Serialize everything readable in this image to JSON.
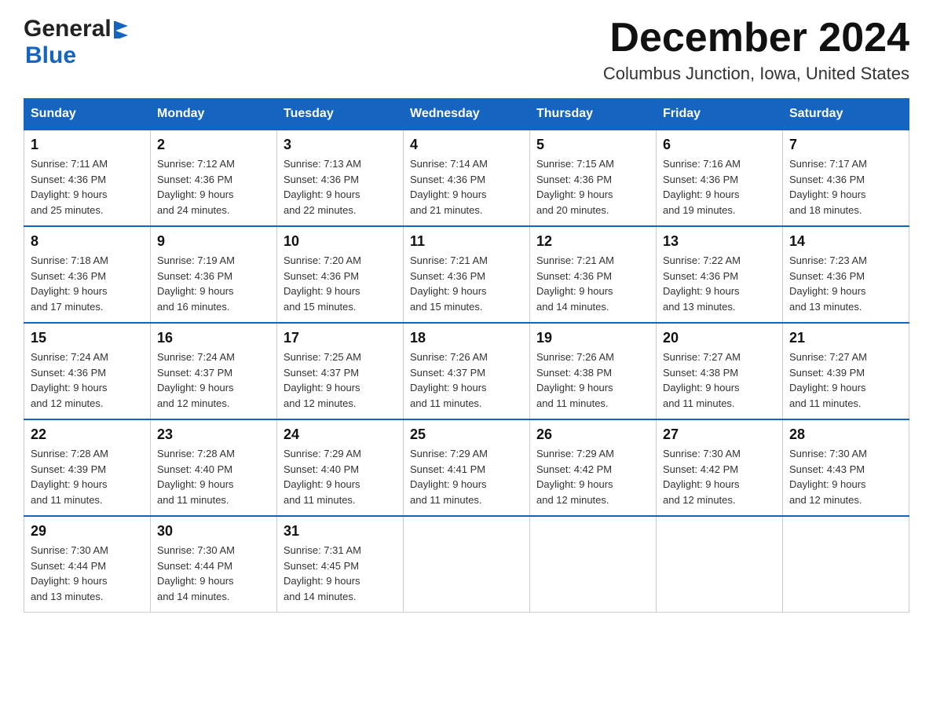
{
  "header": {
    "logo_general": "General",
    "logo_blue": "Blue",
    "month_title": "December 2024",
    "location": "Columbus Junction, Iowa, United States"
  },
  "weekdays": [
    "Sunday",
    "Monday",
    "Tuesday",
    "Wednesday",
    "Thursday",
    "Friday",
    "Saturday"
  ],
  "weeks": [
    [
      {
        "day": "1",
        "sunrise": "7:11 AM",
        "sunset": "4:36 PM",
        "daylight": "9 hours and 25 minutes."
      },
      {
        "day": "2",
        "sunrise": "7:12 AM",
        "sunset": "4:36 PM",
        "daylight": "9 hours and 24 minutes."
      },
      {
        "day": "3",
        "sunrise": "7:13 AM",
        "sunset": "4:36 PM",
        "daylight": "9 hours and 22 minutes."
      },
      {
        "day": "4",
        "sunrise": "7:14 AM",
        "sunset": "4:36 PM",
        "daylight": "9 hours and 21 minutes."
      },
      {
        "day": "5",
        "sunrise": "7:15 AM",
        "sunset": "4:36 PM",
        "daylight": "9 hours and 20 minutes."
      },
      {
        "day": "6",
        "sunrise": "7:16 AM",
        "sunset": "4:36 PM",
        "daylight": "9 hours and 19 minutes."
      },
      {
        "day": "7",
        "sunrise": "7:17 AM",
        "sunset": "4:36 PM",
        "daylight": "9 hours and 18 minutes."
      }
    ],
    [
      {
        "day": "8",
        "sunrise": "7:18 AM",
        "sunset": "4:36 PM",
        "daylight": "9 hours and 17 minutes."
      },
      {
        "day": "9",
        "sunrise": "7:19 AM",
        "sunset": "4:36 PM",
        "daylight": "9 hours and 16 minutes."
      },
      {
        "day": "10",
        "sunrise": "7:20 AM",
        "sunset": "4:36 PM",
        "daylight": "9 hours and 15 minutes."
      },
      {
        "day": "11",
        "sunrise": "7:21 AM",
        "sunset": "4:36 PM",
        "daylight": "9 hours and 15 minutes."
      },
      {
        "day": "12",
        "sunrise": "7:21 AM",
        "sunset": "4:36 PM",
        "daylight": "9 hours and 14 minutes."
      },
      {
        "day": "13",
        "sunrise": "7:22 AM",
        "sunset": "4:36 PM",
        "daylight": "9 hours and 13 minutes."
      },
      {
        "day": "14",
        "sunrise": "7:23 AM",
        "sunset": "4:36 PM",
        "daylight": "9 hours and 13 minutes."
      }
    ],
    [
      {
        "day": "15",
        "sunrise": "7:24 AM",
        "sunset": "4:36 PM",
        "daylight": "9 hours and 12 minutes."
      },
      {
        "day": "16",
        "sunrise": "7:24 AM",
        "sunset": "4:37 PM",
        "daylight": "9 hours and 12 minutes."
      },
      {
        "day": "17",
        "sunrise": "7:25 AM",
        "sunset": "4:37 PM",
        "daylight": "9 hours and 12 minutes."
      },
      {
        "day": "18",
        "sunrise": "7:26 AM",
        "sunset": "4:37 PM",
        "daylight": "9 hours and 11 minutes."
      },
      {
        "day": "19",
        "sunrise": "7:26 AM",
        "sunset": "4:38 PM",
        "daylight": "9 hours and 11 minutes."
      },
      {
        "day": "20",
        "sunrise": "7:27 AM",
        "sunset": "4:38 PM",
        "daylight": "9 hours and 11 minutes."
      },
      {
        "day": "21",
        "sunrise": "7:27 AM",
        "sunset": "4:39 PM",
        "daylight": "9 hours and 11 minutes."
      }
    ],
    [
      {
        "day": "22",
        "sunrise": "7:28 AM",
        "sunset": "4:39 PM",
        "daylight": "9 hours and 11 minutes."
      },
      {
        "day": "23",
        "sunrise": "7:28 AM",
        "sunset": "4:40 PM",
        "daylight": "9 hours and 11 minutes."
      },
      {
        "day": "24",
        "sunrise": "7:29 AM",
        "sunset": "4:40 PM",
        "daylight": "9 hours and 11 minutes."
      },
      {
        "day": "25",
        "sunrise": "7:29 AM",
        "sunset": "4:41 PM",
        "daylight": "9 hours and 11 minutes."
      },
      {
        "day": "26",
        "sunrise": "7:29 AM",
        "sunset": "4:42 PM",
        "daylight": "9 hours and 12 minutes."
      },
      {
        "day": "27",
        "sunrise": "7:30 AM",
        "sunset": "4:42 PM",
        "daylight": "9 hours and 12 minutes."
      },
      {
        "day": "28",
        "sunrise": "7:30 AM",
        "sunset": "4:43 PM",
        "daylight": "9 hours and 12 minutes."
      }
    ],
    [
      {
        "day": "29",
        "sunrise": "7:30 AM",
        "sunset": "4:44 PM",
        "daylight": "9 hours and 13 minutes."
      },
      {
        "day": "30",
        "sunrise": "7:30 AM",
        "sunset": "4:44 PM",
        "daylight": "9 hours and 14 minutes."
      },
      {
        "day": "31",
        "sunrise": "7:31 AM",
        "sunset": "4:45 PM",
        "daylight": "9 hours and 14 minutes."
      },
      null,
      null,
      null,
      null
    ]
  ],
  "cell_labels": {
    "sunrise": "Sunrise:",
    "sunset": "Sunset:",
    "daylight": "Daylight:"
  }
}
